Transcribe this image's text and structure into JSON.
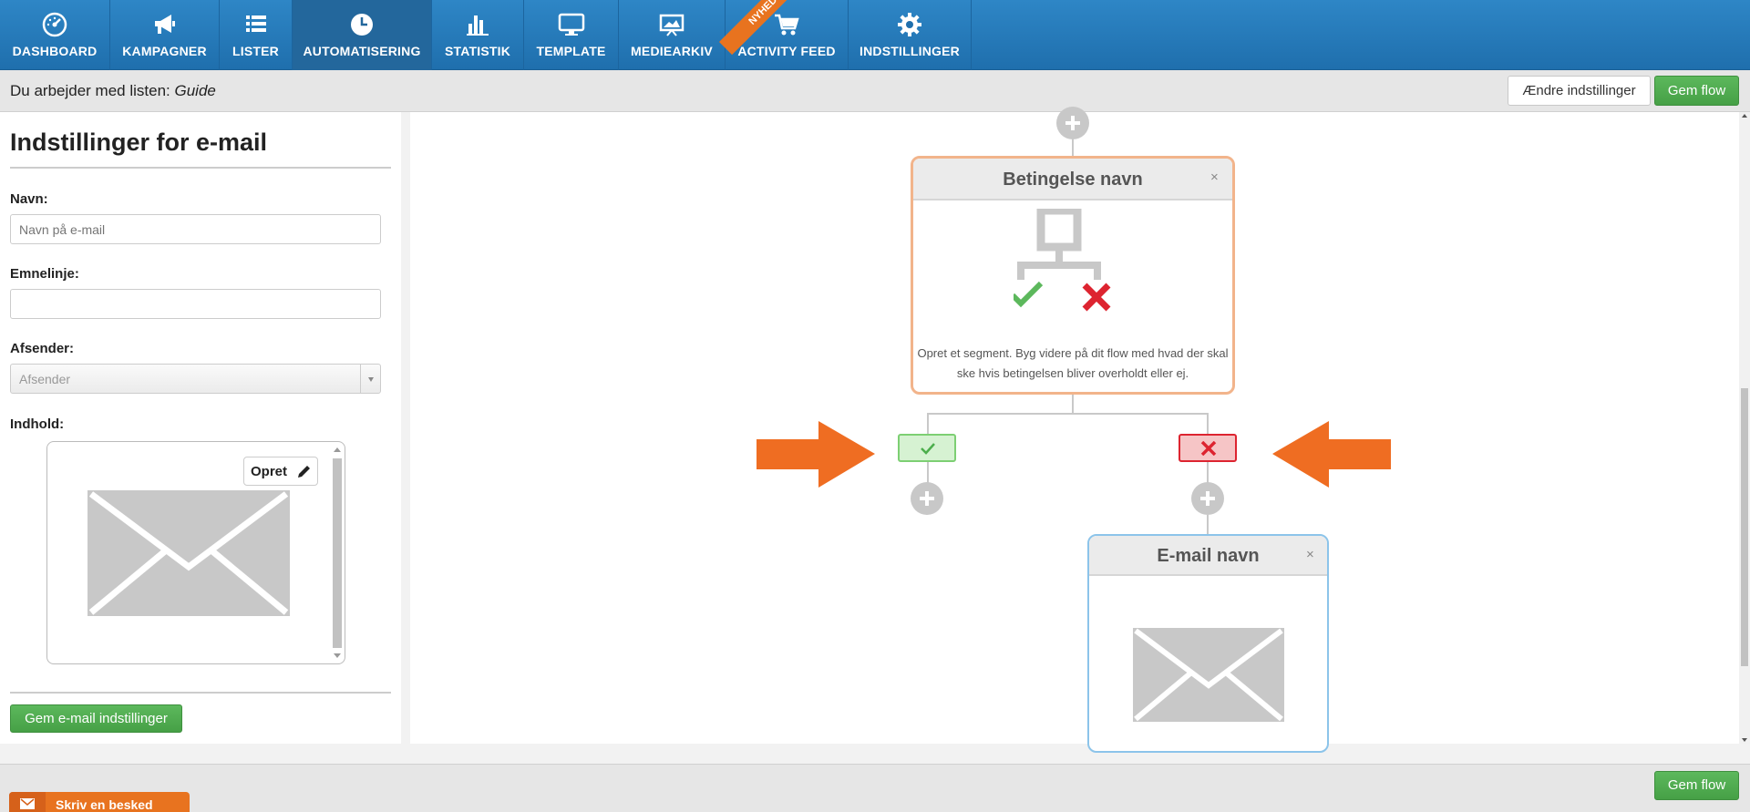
{
  "nav": {
    "items": [
      {
        "label": "DASHBOARD",
        "icon": "dashboard-icon"
      },
      {
        "label": "KAMPAGNER",
        "icon": "megaphone-icon"
      },
      {
        "label": "LISTER",
        "icon": "list-icon"
      },
      {
        "label": "AUTOMATISERING",
        "icon": "clock-icon",
        "active": true
      },
      {
        "label": "STATISTIK",
        "icon": "bar-chart-icon"
      },
      {
        "label": "TEMPLATE",
        "icon": "monitor-icon"
      },
      {
        "label": "MEDIEARKIV",
        "icon": "image-screen-icon"
      },
      {
        "label": "ACTIVITY FEED",
        "icon": "cart-icon"
      },
      {
        "label": "INDSTILLINGER",
        "icon": "gear-icon"
      }
    ],
    "ribbon": "NYHED!"
  },
  "subheader": {
    "prefix": "Du arbejder med listen: ",
    "list_name": "Guide",
    "change_settings": "Ændre indstillinger",
    "save_flow": "Gem flow"
  },
  "panel": {
    "title": "Indstillinger for e-mail",
    "name_label": "Navn:",
    "name_placeholder": "Navn på e-mail",
    "subject_label": "Emnelinje:",
    "subject_value": "",
    "sender_label": "Afsender:",
    "sender_value": "Afsender",
    "content_label": "Indhold:",
    "create_label": "Opret",
    "save_button": "Gem e-mail indstillinger"
  },
  "flow": {
    "condition": {
      "title": "Betingelse navn",
      "close": "×",
      "description": "Opret et segment. Byg videre på dit flow med hvad der skal ske hvis betingelsen bliver overholdt eller ej."
    },
    "email": {
      "title": "E-mail navn",
      "close": "×"
    }
  },
  "colors": {
    "nav": "#1f6fad",
    "green": "#5cb85c",
    "orange": "#ef6d22",
    "red": "#dd2430"
  },
  "bottom": {
    "save_flow": "Gem flow",
    "chat": "Skriv en besked"
  }
}
